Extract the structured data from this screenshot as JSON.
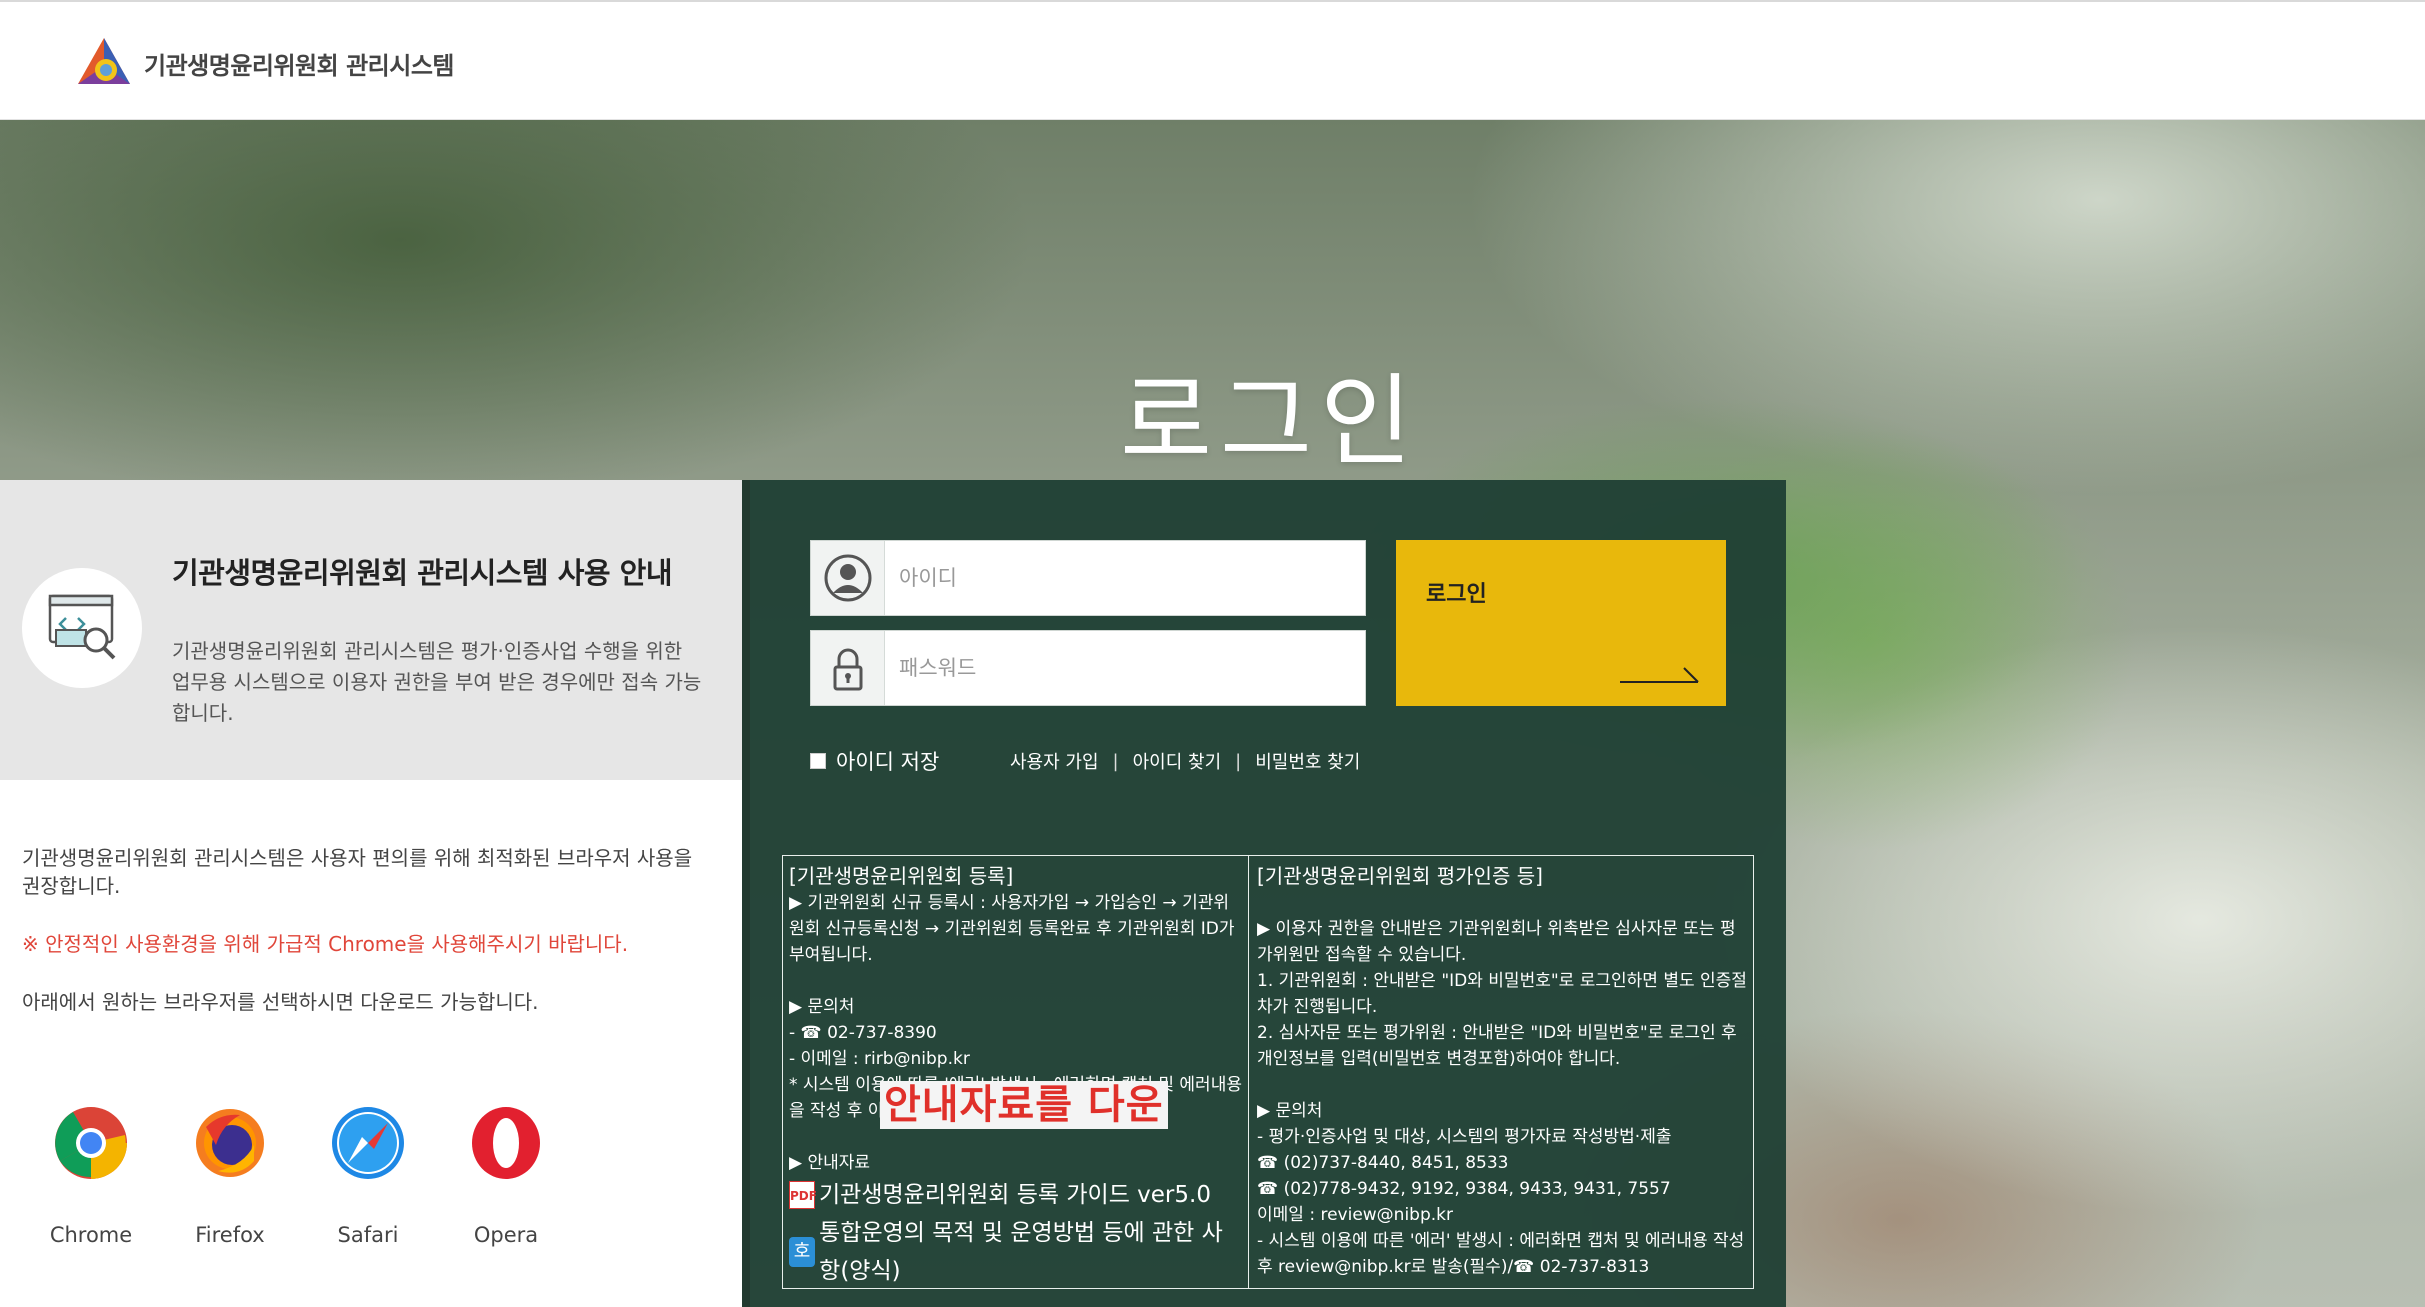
{
  "header": {
    "site_title": "기관생명윤리위원회 관리시스템"
  },
  "hero": {
    "title": "로그인"
  },
  "guide": {
    "heading": "기관생명윤리위원회 관리시스템 사용 안내",
    "description": "기관생명윤리위원회 관리시스템은 평가·인증사업 수행을 위한 업무용 시스템으로 이용자 권한을 부여 받은 경우에만 접속 가능합니다.",
    "browser_notice": "기관생명윤리위원회 관리시스템은 사용자 편의를 위해 최적화된 브라우저 사용을 권장합니다.",
    "chrome_notice": "※ 안정적인 사용환경을 위해 가급적 Chrome을 사용해주시기 바랍니다.",
    "download_notice": "아래에서 원하는 브라우저를 선택하시면 다운로드 가능합니다.",
    "browsers": [
      {
        "label": "Chrome",
        "icon": "chrome-icon"
      },
      {
        "label": "Firefox",
        "icon": "firefox-icon"
      },
      {
        "label": "Safari",
        "icon": "safari-icon"
      },
      {
        "label": "Opera",
        "icon": "opera-icon"
      }
    ]
  },
  "login": {
    "id_placeholder": "아이디",
    "password_placeholder": "패스워드",
    "button_label": "로그인",
    "remember_label": "아이디 저장",
    "links": [
      "사용자 가입",
      "아이디 찾기",
      "비밀번호 찾기"
    ]
  },
  "info": {
    "left": {
      "heading": "[기관생명윤리위원회 등록]",
      "register_line": "▶ 기관위원회 신규 등록시 : 사용자가입 → 가입승인 → 기관위원회 신규등록신청 → 기관위원회 등록완료 후 기관위원회 ID가 부여됩니다.",
      "contact_heading": "▶ 문의처",
      "phone": "- ☎ 02-737-8390",
      "email": "- 이메일 : rirb@nibp.kr",
      "error_note": "* 시스템 이용에 따른 '에러' 발생시 : 에러화면 캡처 및 에러내용을 작성 후 이메일 발송",
      "materials_heading": "▶ 안내자료",
      "banner": "안내자료를 다운",
      "guide_file": "기관생명윤리위원회 등록 가이드 ver5.0",
      "hwp_file": "통합운영의 목적 및 운영방법 등에 관한 사항(양식)",
      "hwp_glyph": "호"
    },
    "right": {
      "heading": "[기관생명윤리위원회 평가인증 등]",
      "line1": "▶ 이용자 권한을 안내받은 기관위원회나 위촉받은 심사자문 또는 평가위원만 접속할 수 있습니다.",
      "line2": "1. 기관위원회 : 안내받은 \"ID와 비밀번호\"로 로그인하면 별도 인증절차가 진행됩니다.",
      "line3": "2. 심사자문 또는 평가위원 : 안내받은 \"ID와 비밀번호\"로 로그인 후 개인정보를 입력(비밀번호 변경포함)하여야 합니다.",
      "contact_heading": "▶ 문의처",
      "contact_desc": "- 평가·인증사업 및 대상, 시스템의 평가자료 작성방법·제출",
      "phone1": "☎ (02)737-8440, 8451, 8533",
      "phone2": "☎ (02)778-9432, 9192, 9384, 9433, 9431, 7557",
      "email": "이메일 : review@nibp.kr",
      "error_note": "- 시스템 이용에 따른 '에러' 발생시 : 에러화면 캡처 및 에러내용 작성 후 review@nibp.kr로 발송(필수)/☎ 02-737-8313"
    }
  },
  "colors": {
    "accent": "#e8b80c",
    "panel": "#1f3f34",
    "warning": "#e0463a"
  }
}
